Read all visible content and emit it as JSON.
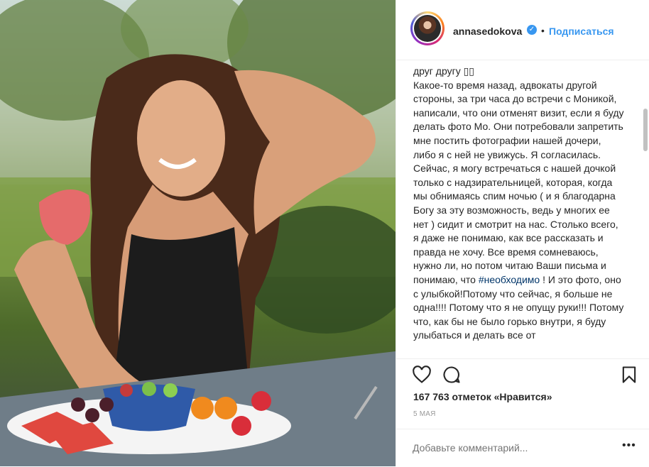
{
  "header": {
    "username": "annasedokova",
    "verified_mark": "✓",
    "separator": "•",
    "follow_label": "Подписаться"
  },
  "caption": {
    "text": "друг другу ▯▯\nКакое-то время назад, адвокаты другой стороны, за три часа до встречи с Моникой, написали, что они отменят визит, если я буду делать фото Мо. Они потребовали запретить мне постить фотографии нашей дочери, либо я с ней не увижусь. Я согласилась. Сейчас, я могу встречаться с нашей дочкой только с надзирательницей, которая, когда мы обнимаясь спим ночью ( и я благодарна Богу за эту возможность, ведь у многих ее нет ) сидит и смотрит на нас. Столько всего, я даже не понимаю, как все рассказать и правда не хочу. Все время сомневаюсь, нужно ли, но потом читаю Ваши письма и понимаю, что",
    "hashtag": "#необходимо",
    "text_after": " ! И это фото, оно с улыбкой!Потому что сейчас, я больше не одна!!!! Потому что я не опущу руки!!! Потому что, как бы не было горько внутри, я буду улыбаться и делать все от"
  },
  "actions": {
    "like_icon": "heart-icon",
    "comment_icon": "comment-icon",
    "save_icon": "bookmark-icon"
  },
  "likes": "167 763 отметок «Нравится»",
  "date": "5 мая",
  "comment": {
    "placeholder": "Добавьте комментарий...",
    "more_label": "•••"
  },
  "colors": {
    "link": "#3897f0",
    "hashtag": "#003569",
    "text": "#262626",
    "muted": "#999999"
  }
}
